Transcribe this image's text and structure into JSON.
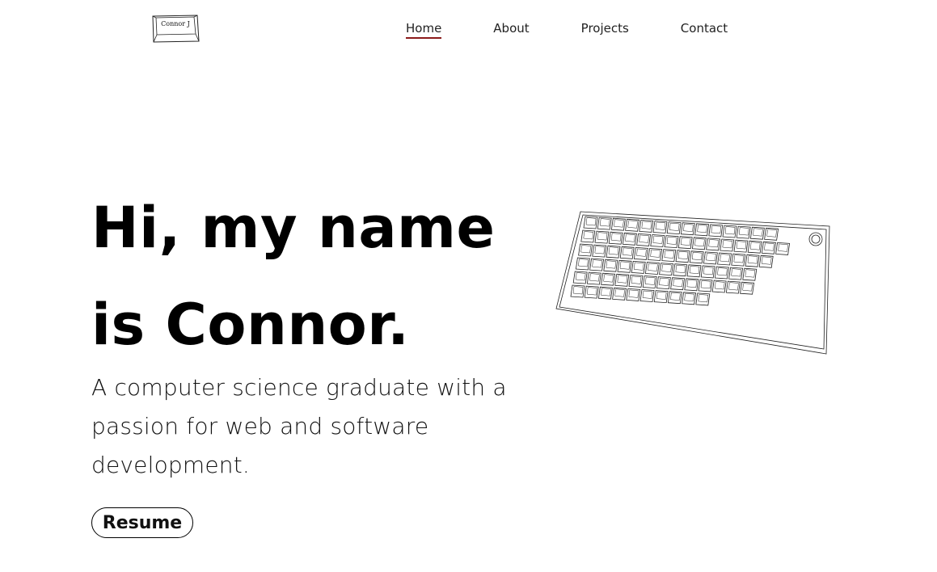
{
  "logo": {
    "text": "Connor J",
    "icon": "keycap-logo-icon"
  },
  "nav": {
    "items": [
      {
        "label": "Home",
        "active": true
      },
      {
        "label": "About",
        "active": false
      },
      {
        "label": "Projects",
        "active": false
      },
      {
        "label": "Contact",
        "active": false
      }
    ]
  },
  "hero": {
    "headline_line1": "Hi, my name",
    "headline_line2": "is Connor.",
    "subtitle": "A computer science graduate with a passion for web and software development.",
    "resume_label": "Resume",
    "illustration": "mechanical-keyboard-icon"
  },
  "colors": {
    "nav_active_underline": "#8b1a1a",
    "text": "#000000",
    "background": "#ffffff"
  }
}
